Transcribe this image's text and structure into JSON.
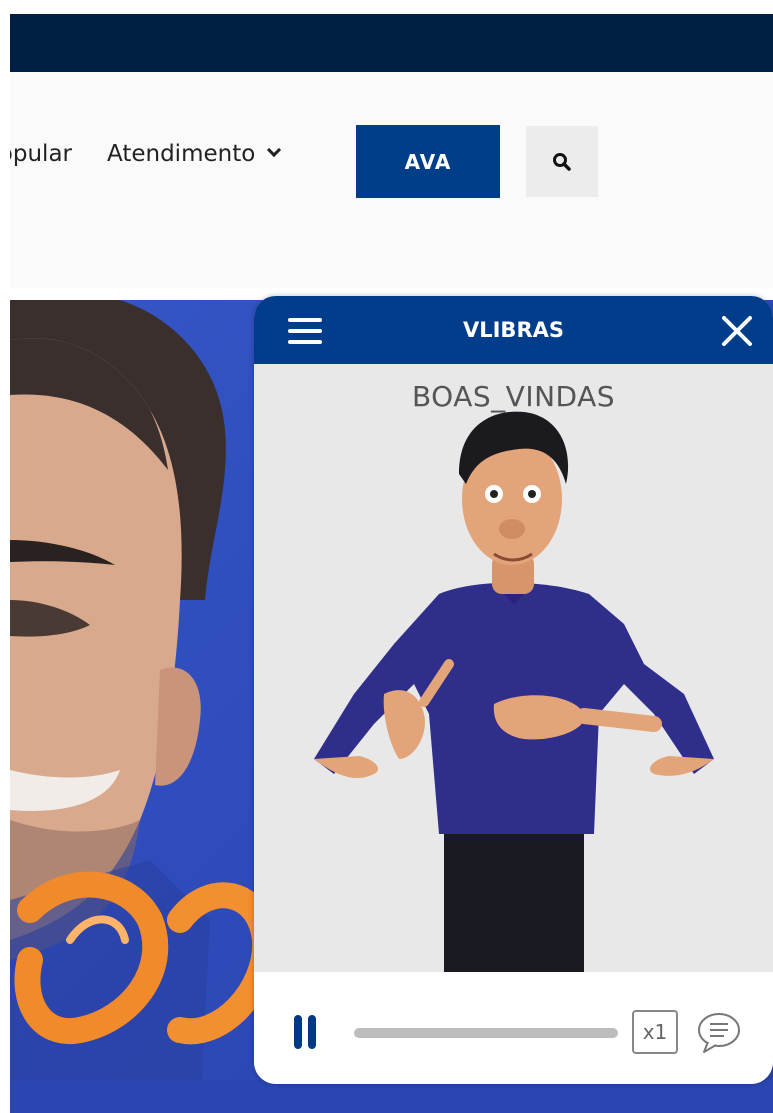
{
  "nav": {
    "partial_link": "Popular",
    "atendimento": "Atendimento",
    "ava_button": "AVA"
  },
  "widget": {
    "title": "VLIBRAS",
    "gloss": "BOAS_VINDAS",
    "speed": "x1",
    "progress": 0.0
  },
  "colors": {
    "topbar": "#001f45",
    "accent": "#003e8a",
    "hero": "#2d4ab8"
  },
  "icons": [
    "chevron-down-icon",
    "search-icon",
    "menu-icon",
    "close-icon",
    "pause-icon",
    "subtitles-icon"
  ]
}
